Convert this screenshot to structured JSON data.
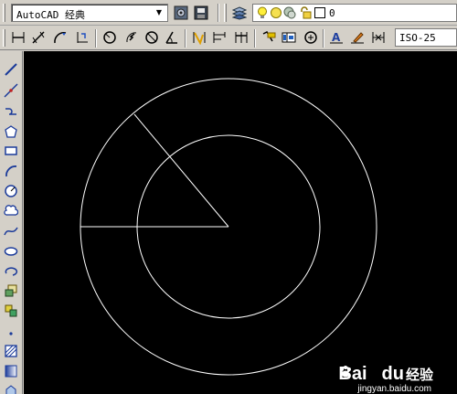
{
  "toolbar_top": {
    "workspace_value": "AutoCAD 经典",
    "layer_value": "0",
    "icons": [
      "workspace-settings-icon",
      "workspace-save-icon",
      "layer-manager-icon",
      "lightbulb-icon",
      "sun-icon",
      "layer-state-icon",
      "lock-icon",
      "color-swatch-icon"
    ]
  },
  "toolbar_dim": {
    "dimstyle_value": "ISO-25",
    "icons": [
      "dim-linear-icon",
      "dim-aligned-icon",
      "dim-arc-icon",
      "dim-ordinate-icon",
      "dim-radius-icon",
      "dim-jogged-icon",
      "dim-diameter-icon",
      "dim-angular-icon",
      "quick-dim-icon",
      "dim-baseline-icon",
      "dim-continue-icon",
      "quick-leader-icon",
      "tolerance-icon",
      "center-mark-icon",
      "dim-edit-icon",
      "dim-text-edit-icon",
      "dim-update-icon"
    ]
  },
  "draw_toolbar": {
    "icons": [
      "line-icon",
      "construction-line-icon",
      "polyline-icon",
      "polygon-icon",
      "rectangle-icon",
      "arc-icon",
      "circle-icon",
      "revcloud-icon",
      "spline-icon",
      "ellipse-icon",
      "ellipse-arc-icon",
      "insert-block-icon",
      "make-block-icon",
      "point-icon",
      "hatch-icon",
      "gradient-icon",
      "region-icon"
    ]
  },
  "colors": {
    "ui_face": "#d4d0c8",
    "canvas_bg": "#000000",
    "drawing_line": "#ffffff"
  },
  "watermark": {
    "brand": "Bai",
    "brand_tail": "du",
    "suffix": "经验",
    "url": "jingyan.baidu.com"
  }
}
